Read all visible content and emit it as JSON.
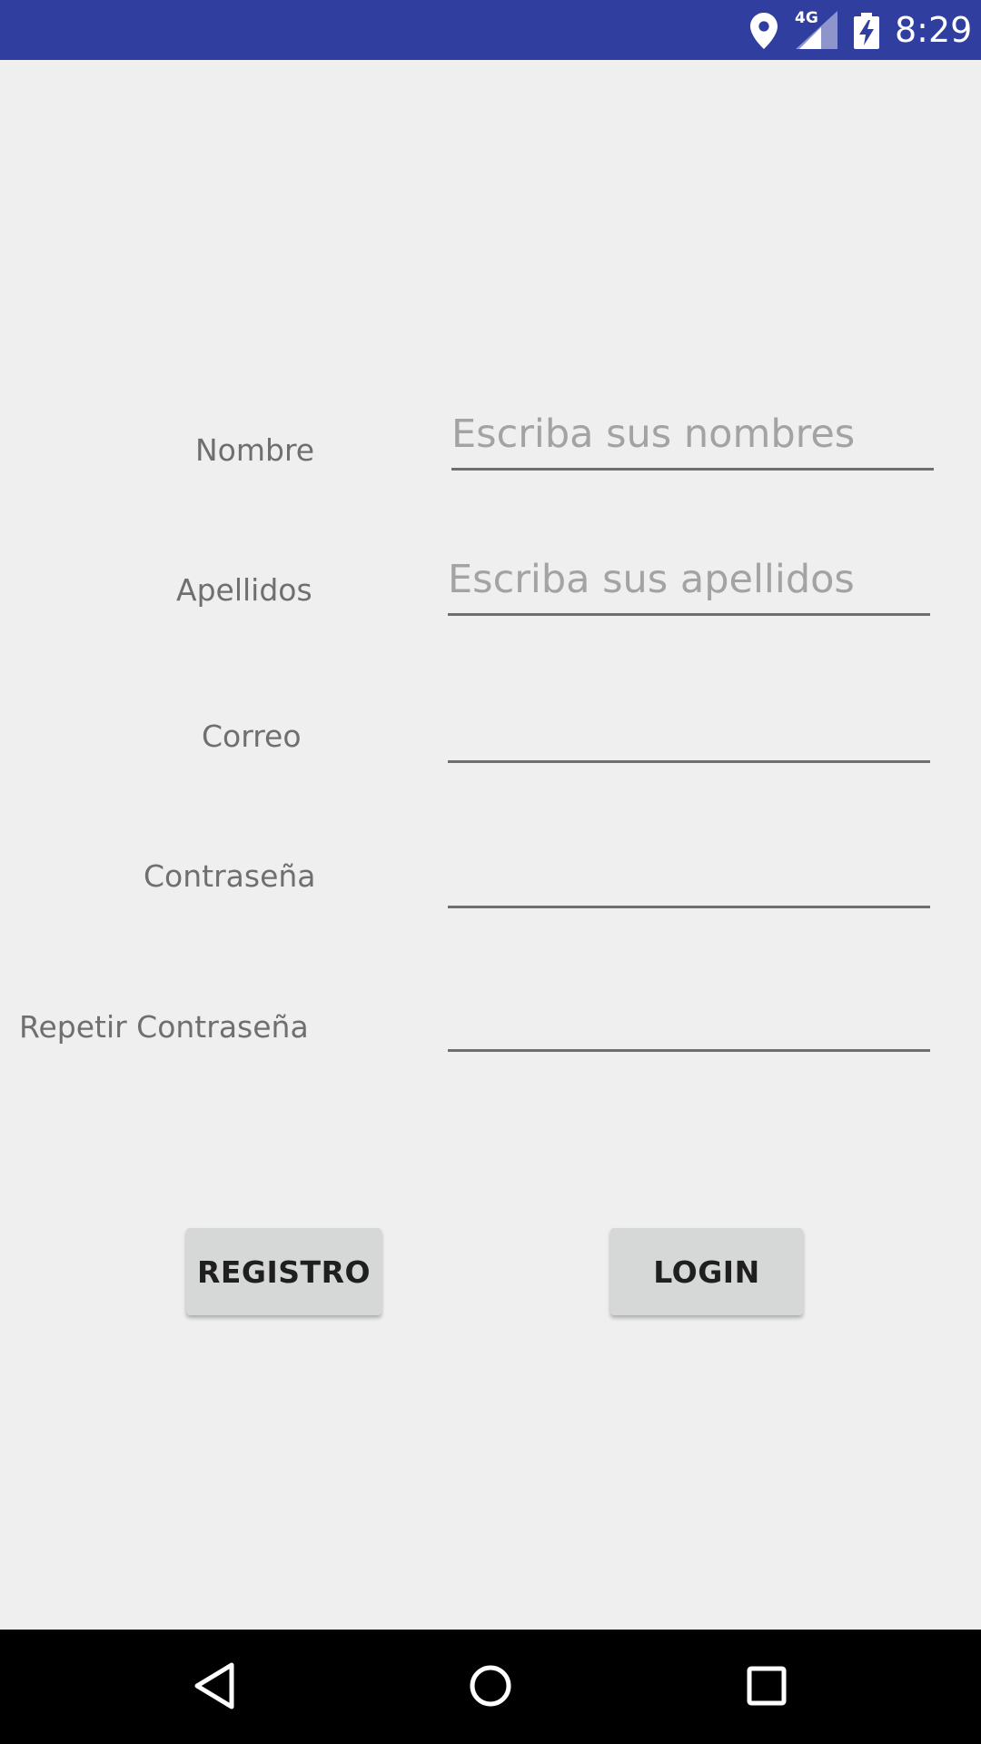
{
  "status_bar": {
    "network_type": "4G",
    "time": "8:29",
    "icons": [
      "location-icon",
      "signal-icon",
      "battery-charging-icon"
    ]
  },
  "form": {
    "nombre": {
      "label": "Nombre",
      "value": "",
      "placeholder": "Escriba sus nombres"
    },
    "apellidos": {
      "label": "Apellidos",
      "value": "",
      "placeholder": "Escriba sus apellidos"
    },
    "correo": {
      "label": "Correo",
      "value": "",
      "placeholder": ""
    },
    "contrasena": {
      "label": "Contraseña",
      "value": "",
      "placeholder": ""
    },
    "repetir_contrasena": {
      "label": "Repetir Contraseña",
      "value": "",
      "placeholder": ""
    }
  },
  "buttons": {
    "registro": "REGISTRO",
    "login": "LOGIN"
  },
  "nav_bar": {
    "icons": [
      "back-icon",
      "home-icon",
      "recents-icon"
    ]
  },
  "colors": {
    "status_bar": "#303f9f",
    "background": "#efefef",
    "button": "#d6d7d7",
    "nav_bar": "#000000"
  }
}
